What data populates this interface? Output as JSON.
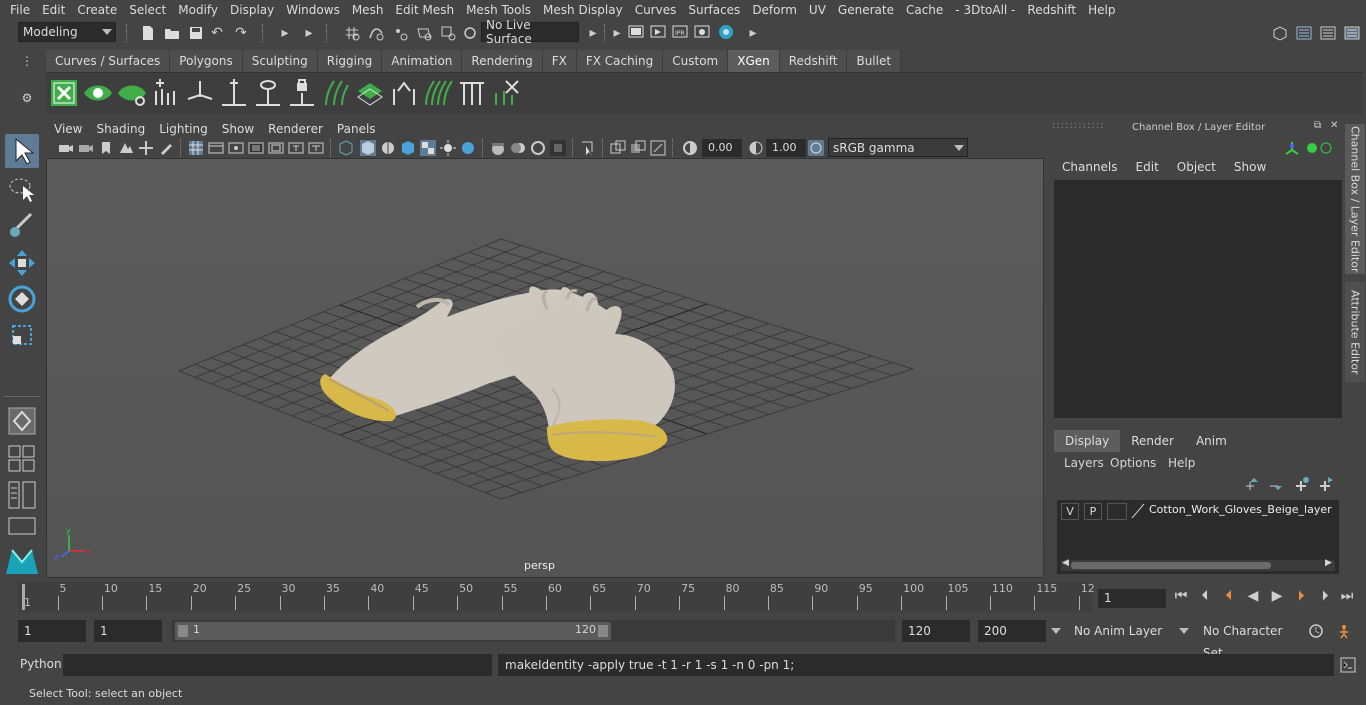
{
  "menubar": [
    "File",
    "Edit",
    "Create",
    "Select",
    "Modify",
    "Display",
    "Windows",
    "Mesh",
    "Edit Mesh",
    "Mesh Tools",
    "Mesh Display",
    "Curves",
    "Surfaces",
    "Deform",
    "UV",
    "Generate",
    "Cache",
    "- 3DtoAll -",
    "Redshift",
    "Help"
  ],
  "status": {
    "mode": "Modeling",
    "live_surface": "No Live Surface"
  },
  "shelf": {
    "tabs": [
      "Curves / Surfaces",
      "Polygons",
      "Sculpting",
      "Rigging",
      "Animation",
      "Rendering",
      "FX",
      "FX Caching",
      "Custom",
      "XGen",
      "Redshift",
      "Bullet"
    ],
    "active_tab": "XGen"
  },
  "viewport": {
    "menu": [
      "View",
      "Shading",
      "Lighting",
      "Show",
      "Renderer",
      "Panels"
    ],
    "exposure": "0.00",
    "gamma": "1.00",
    "colorspace": "sRGB gamma",
    "camera_label": "persp"
  },
  "channelbox": {
    "title": "Channel Box / Layer Editor",
    "menu": [
      "Channels",
      "Edit",
      "Object",
      "Show"
    ],
    "side_tabs": [
      "Channel Box / Layer Editor",
      "Attribute Editor"
    ]
  },
  "layers": {
    "tabs": [
      "Display",
      "Render",
      "Anim"
    ],
    "active_tab": "Display",
    "menu": [
      "Layers",
      "Options",
      "Help"
    ],
    "rows": [
      {
        "v": "V",
        "p": "P",
        "name": "Cotton_Work_Gloves_Beige_layer"
      }
    ]
  },
  "timeline": {
    "ticks": [
      "5",
      "10",
      "15",
      "20",
      "25",
      "30",
      "35",
      "40",
      "45",
      "50",
      "55",
      "60",
      "65",
      "70",
      "75",
      "80",
      "85",
      "90",
      "95",
      "100",
      "105",
      "110",
      "115",
      "12"
    ],
    "start_marker": "1",
    "current_frame": "1"
  },
  "range": {
    "start": "1",
    "playback_start": "1",
    "slider_start": "1",
    "slider_end": "120",
    "playback_end": "120",
    "end": "200",
    "anim_layer": "No Anim Layer",
    "char_set": "No Character Set"
  },
  "command": {
    "language": "Python",
    "output": "makeIdentity -apply true -t 1 -r 1 -s 1 -n 0 -pn 1;"
  },
  "help_line": "Select Tool: select an object",
  "colors": {
    "accent": "#5f7c96",
    "xgen_green": "#3fae49",
    "panel": "#444444",
    "field": "#2b2b2b",
    "glove_cuff": "#d9b84a"
  }
}
